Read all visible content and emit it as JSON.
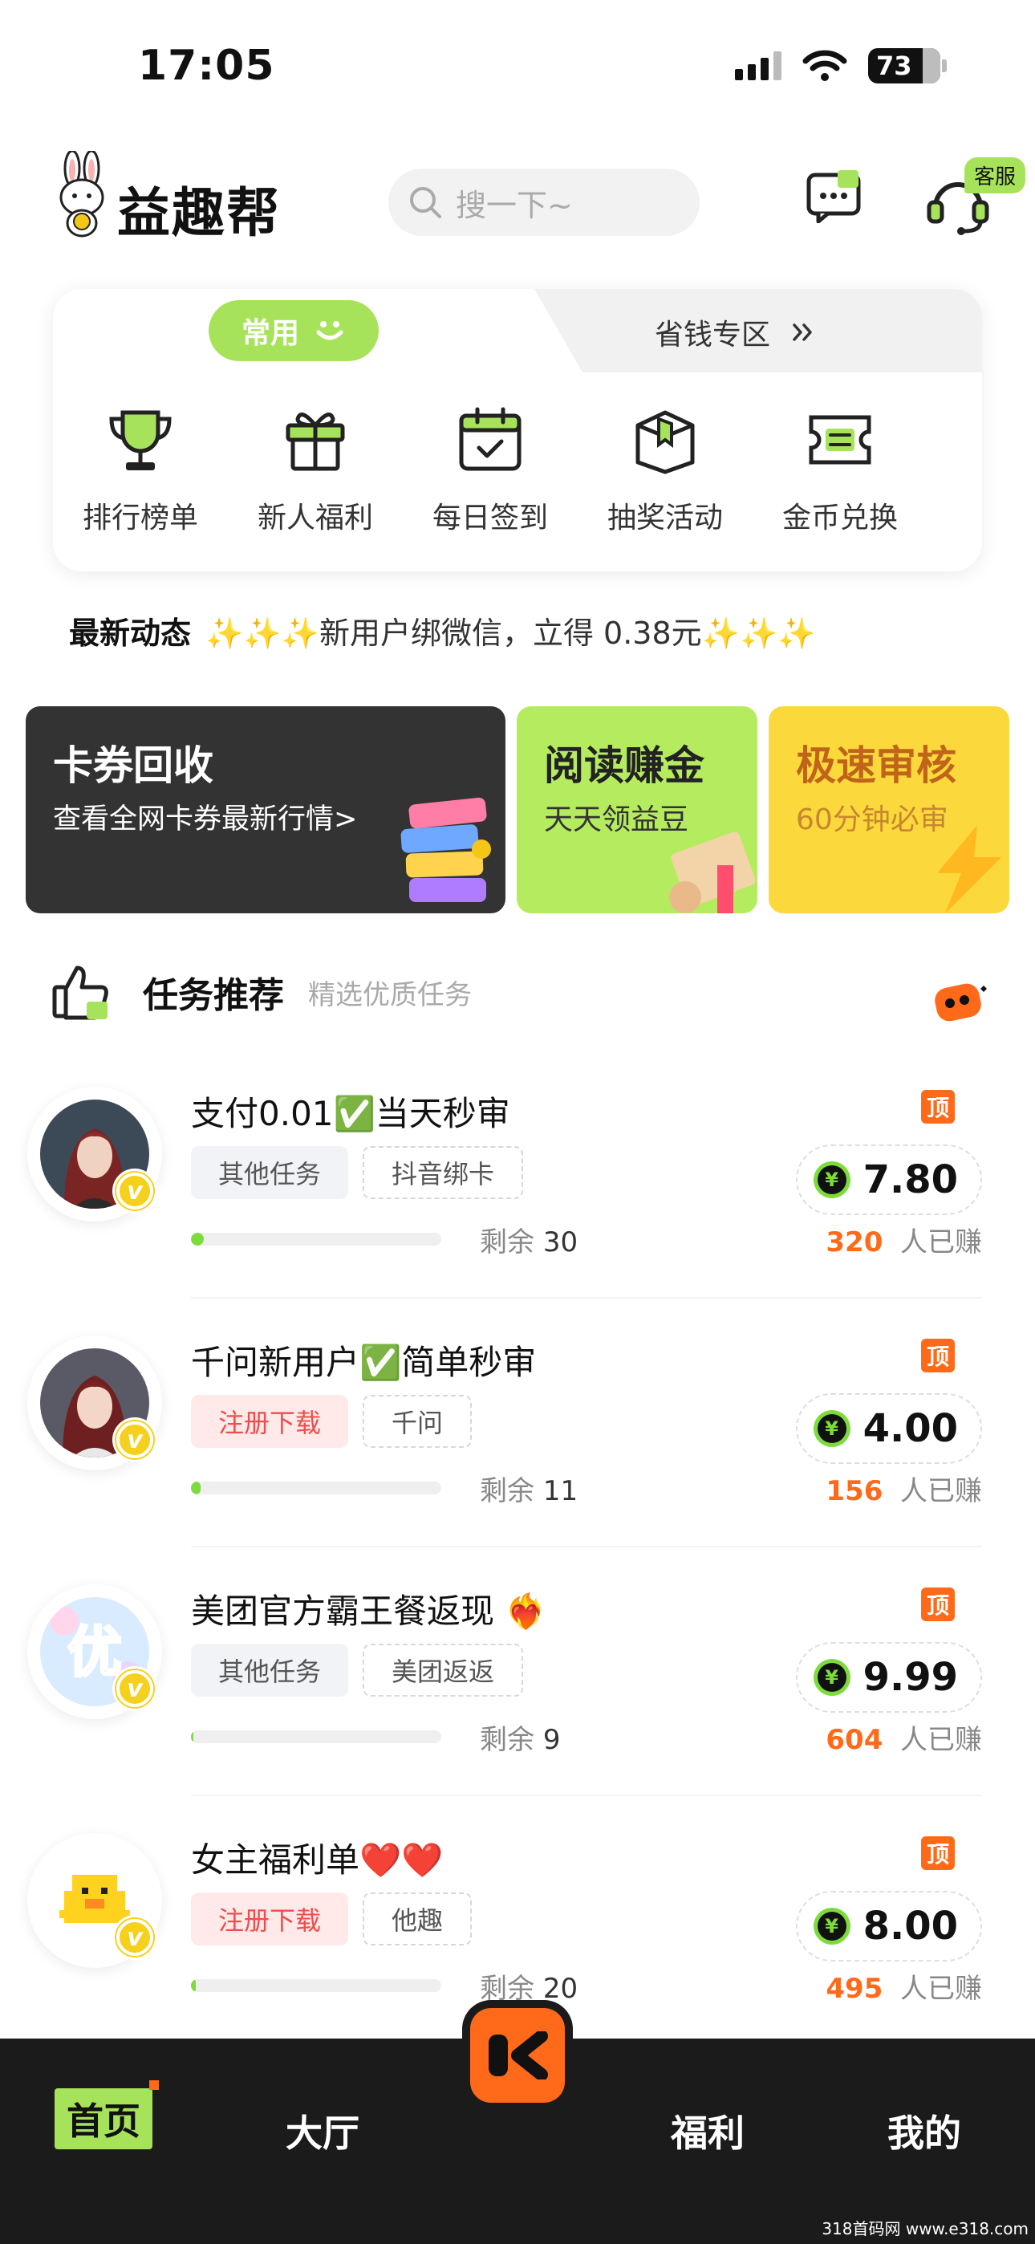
{
  "status_bar": {
    "time": "17:05",
    "battery": "73"
  },
  "header": {
    "app_name": "益趣帮",
    "search_placeholder": "搜一下~",
    "cs_badge": "客服"
  },
  "quick_panel": {
    "tab_active": "常用",
    "tab_other": "省钱专区",
    "items": [
      {
        "label": "排行榜单",
        "icon": "trophy-icon"
      },
      {
        "label": "新人福利",
        "icon": "gift-icon"
      },
      {
        "label": "每日签到",
        "icon": "calendar-check-icon"
      },
      {
        "label": "抽奖活动",
        "icon": "lottery-box-icon"
      },
      {
        "label": "金币兑换",
        "icon": "coupon-icon"
      }
    ]
  },
  "news": {
    "title": "最新动态",
    "text": "✨✨✨新用户绑微信，立得 0.38元✨✨✨"
  },
  "banners": [
    {
      "title": "卡券回收",
      "subtitle": "查看全网卡券最新行情>",
      "bg": "#333333"
    },
    {
      "title": "阅读赚金",
      "subtitle": "天天领益豆",
      "bg": "#b5ec5f"
    },
    {
      "title": "极速审核",
      "subtitle": "60分钟必审",
      "bg": "#fbd93d"
    }
  ],
  "section": {
    "title": "任务推荐",
    "subtitle": "精选优质任务"
  },
  "tasks": [
    {
      "title": "支付0.01✅当天秒审",
      "tags": [
        "其他任务",
        "抖音绑卡"
      ],
      "tag_styles": [
        "gray",
        "dash"
      ],
      "remaining_label": "剩余",
      "remaining": "30",
      "progress": 0.05,
      "price": "7.80",
      "earned_count": "320",
      "earned_label": "人已赚",
      "top_badge": "顶",
      "avatar": "girl"
    },
    {
      "title": "千问新用户✅简单秒审",
      "tags": [
        "注册下载",
        "千问"
      ],
      "tag_styles": [
        "red",
        "dash"
      ],
      "remaining_label": "剩余",
      "remaining": "11",
      "progress": 0.04,
      "price": "4.00",
      "earned_count": "156",
      "earned_label": "人已赚",
      "top_badge": "顶",
      "avatar": "girl"
    },
    {
      "title": "美团官方霸王餐返现 ❤️‍🔥",
      "tags": [
        "其他任务",
        "美团返返"
      ],
      "tag_styles": [
        "gray",
        "dash"
      ],
      "remaining_label": "剩余",
      "remaining": "9",
      "progress": 0.01,
      "price": "9.99",
      "earned_count": "604",
      "earned_label": "人已赚",
      "top_badge": "顶",
      "avatar": "you"
    },
    {
      "title": "女主福利单❤️❤️",
      "tags": [
        "注册下载",
        "他趣"
      ],
      "tag_styles": [
        "red",
        "dash"
      ],
      "remaining_label": "剩余",
      "remaining": "20",
      "progress": 0.02,
      "price": "8.00",
      "earned_count": "495",
      "earned_label": "人已赚",
      "top_badge": "顶",
      "avatar": "duck"
    }
  ],
  "bottom_nav": {
    "home": "首页",
    "hall": "大厅",
    "welfare": "福利",
    "mine": "我的"
  },
  "watermark": "318首码网 www.e318.com",
  "colors": {
    "accent": "#a7e35a",
    "orange": "#ff6a1a",
    "dark": "#1b1b1b"
  }
}
